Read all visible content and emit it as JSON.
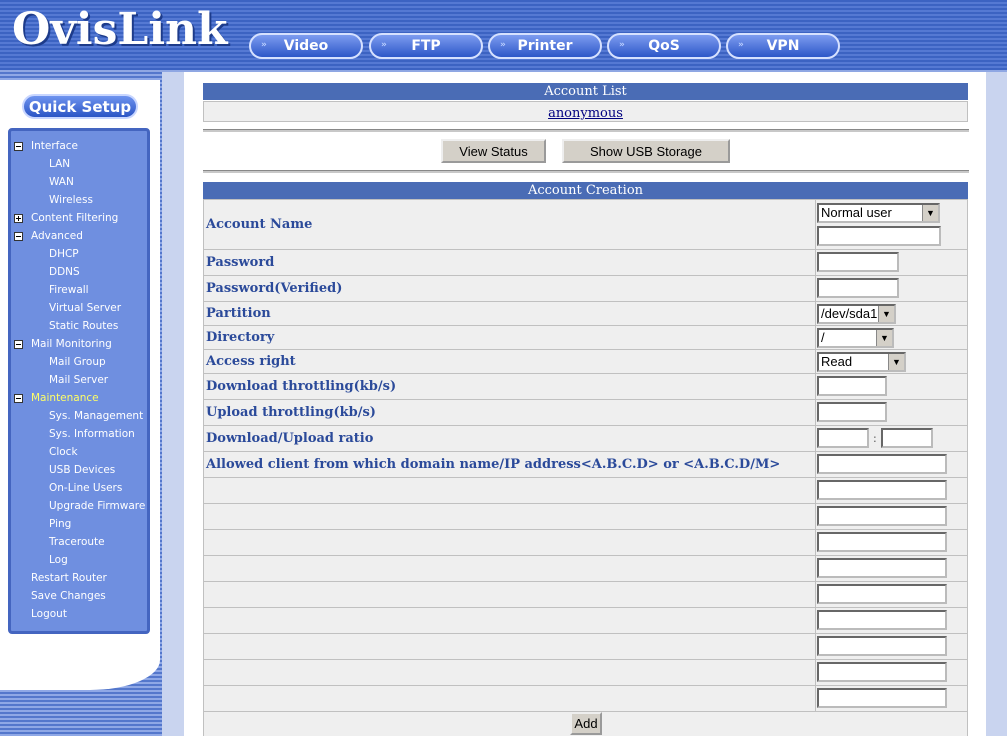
{
  "header": {
    "logo": "OvisLink",
    "nav": [
      "Video",
      "FTP",
      "Printer",
      "QoS",
      "VPN"
    ]
  },
  "sidebar": {
    "quick_setup": "Quick Setup",
    "items": [
      {
        "label": "Interface",
        "toggle": "minus"
      },
      {
        "label": "LAN"
      },
      {
        "label": "WAN"
      },
      {
        "label": "Wireless"
      },
      {
        "label": "Content Filtering",
        "toggle": "plus"
      },
      {
        "label": "Advanced",
        "toggle": "minus"
      },
      {
        "label": "DHCP"
      },
      {
        "label": "DDNS"
      },
      {
        "label": "Firewall"
      },
      {
        "label": "Virtual Server"
      },
      {
        "label": "Static Routes"
      },
      {
        "label": "Mail Monitoring",
        "toggle": "minus"
      },
      {
        "label": "Mail Group"
      },
      {
        "label": "Mail Server"
      },
      {
        "label": "Maintenance",
        "toggle": "minus",
        "active": true
      },
      {
        "label": "Sys. Management"
      },
      {
        "label": "Sys. Information"
      },
      {
        "label": "Clock"
      },
      {
        "label": "USB Devices"
      },
      {
        "label": "On-Line Users"
      },
      {
        "label": "Upgrade Firmware"
      },
      {
        "label": "Ping"
      },
      {
        "label": "Traceroute"
      },
      {
        "label": "Log"
      },
      {
        "label": "Restart Router"
      },
      {
        "label": "Save Changes"
      },
      {
        "label": "Logout"
      }
    ]
  },
  "account_list": {
    "title": "Account List",
    "accounts": [
      "anonymous"
    ]
  },
  "buttons": {
    "view_status": "View Status",
    "show_usb": "Show USB Storage",
    "add": "Add"
  },
  "account_creation": {
    "title": "Account Creation",
    "account_name_label": "Account Name",
    "account_type": "Normal user",
    "password_label": "Password",
    "password_verified_label": "Password(Verified)",
    "partition_label": "Partition",
    "partition_value": "/dev/sda1",
    "directory_label": "Directory",
    "directory_value": "/",
    "access_right_label": "Access right",
    "access_right_value": "Read",
    "download_label": "Download throttling(kb/s)",
    "upload_label": "Upload throttling(kb/s)",
    "ratio_label": "Download/Upload ratio",
    "ratio_separator": ":",
    "allowed_label": "Allowed client from which domain name/IP address<A.B.C.D> or <A.B.C.D/M>"
  }
}
